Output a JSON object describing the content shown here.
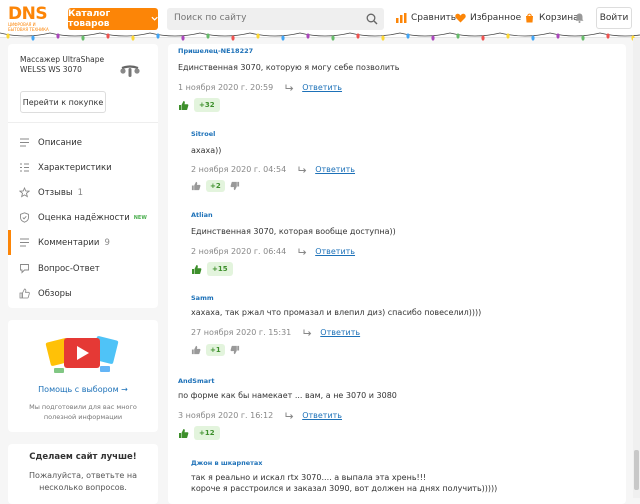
{
  "header": {
    "logo_text": "DNS",
    "logo_sub": "ЦИФРОВАЯ И БЫТОВАЯ ТЕХНИКА",
    "catalog_label": "Каталог товаров",
    "search_placeholder": "Поиск по сайту",
    "compare_label": "Сравнить",
    "favorites_label": "Избранное",
    "cart_label": "Корзина",
    "login_label": "Войти"
  },
  "sidebar": {
    "product_name": "Массажер UltraShape WELSS WS 3070",
    "to_purchase_label": "Перейти к покупке",
    "menu": [
      {
        "label": "Описание",
        "icon": "description-icon"
      },
      {
        "label": "Характеристики",
        "icon": "specs-icon"
      },
      {
        "label": "Отзывы",
        "count": "1",
        "icon": "star-icon"
      },
      {
        "label": "Оценка надёжности",
        "badge": "NEW",
        "icon": "shield-icon"
      },
      {
        "label": "Комментарии",
        "count": "9",
        "icon": "comments-icon"
      },
      {
        "label": "Вопрос-Ответ",
        "icon": "question-icon"
      },
      {
        "label": "Обзоры",
        "icon": "thumb-icon"
      }
    ],
    "help": {
      "link": "Помощь с выбором →",
      "text": "Мы подготовили для вас много полезной информации"
    },
    "survey": {
      "title": "Сделаем сайт лучше!",
      "text": "Пожалуйста, ответьте на несколько вопросов."
    }
  },
  "comments": [
    {
      "author": "Пришелец-NE18227",
      "text": "Единственная 3070, которую я могу себе позволить",
      "date": "1 ноября 2020 г. 20:59",
      "reply": "Ответить",
      "votes": "+32"
    },
    {
      "author": "Sitroel",
      "text": "ахаха))",
      "date": "2 ноября 2020 г. 04:54",
      "reply": "Ответить",
      "votes": "+2"
    },
    {
      "author": "Atlian",
      "text": "Единственная 3070, которая вообще доступна))",
      "date": "2 ноября 2020 г. 06:44",
      "reply": "Ответить",
      "votes": "+15"
    },
    {
      "author": "Samm",
      "text": "хахаха, так ржал что промазал и влепил диз) спасибо повеселил))))",
      "date": "27 ноября 2020 г. 15:31",
      "reply": "Ответить",
      "votes": "+1"
    },
    {
      "author": "AndSmart",
      "text": "по форме как бы намекает ... вам, а не 3070 и 3080",
      "date": "3 ноября 2020 г. 16:12",
      "reply": "Ответить",
      "votes": "+12"
    },
    {
      "author": "Джон в шкарпетах",
      "text": "так я реально и искал rtx 3070.... а выпала эта хрень!!!",
      "text2": "короче я расстроился и заказал 3090, вот должен на днях получить)))))"
    }
  ],
  "colors": {
    "accent": "#fc8507",
    "link": "#1d71b8",
    "vote_bg": "#e3f4dd",
    "vote_text": "#3d8f2b"
  }
}
